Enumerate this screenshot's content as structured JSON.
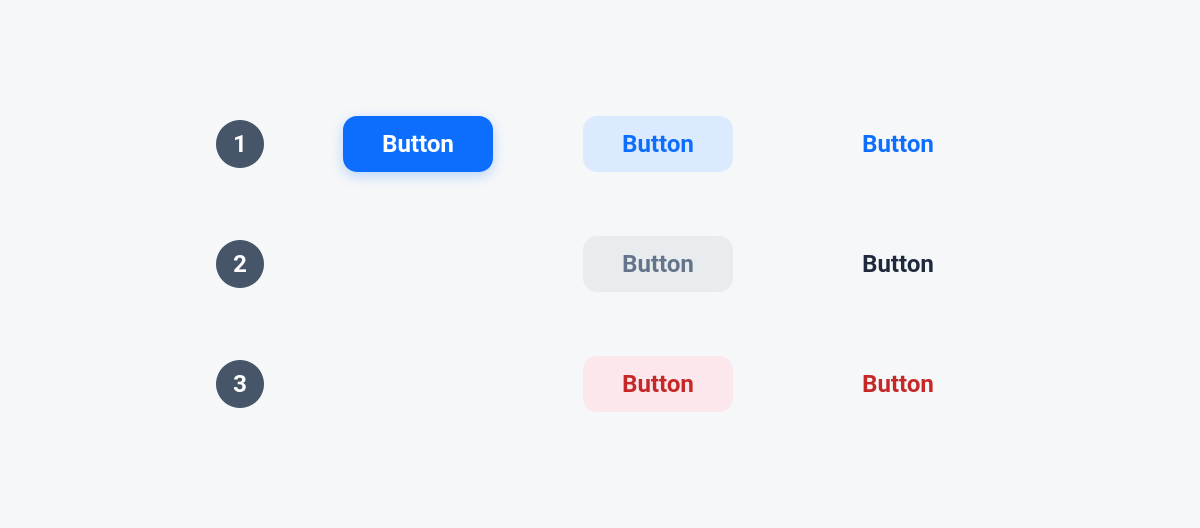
{
  "rows": [
    {
      "badge": "1"
    },
    {
      "badge": "2"
    },
    {
      "badge": "3"
    }
  ],
  "buttons": {
    "row1": {
      "solid": "Button",
      "soft": "Button",
      "ghost": "Button"
    },
    "row2": {
      "soft": "Button",
      "ghost": "Button"
    },
    "row3": {
      "soft": "Button",
      "ghost": "Button"
    }
  },
  "colors": {
    "primary": "#0d6efd",
    "primarySoftBg": "#dbeafe",
    "neutralSoftBg": "#e9ecef",
    "neutralText": "#64748b",
    "dark": "#1e293b",
    "dangerSoftBg": "#fce7ec",
    "danger": "#c62828",
    "badgeBg": "#475569",
    "pageBg": "#f5f7f9"
  }
}
